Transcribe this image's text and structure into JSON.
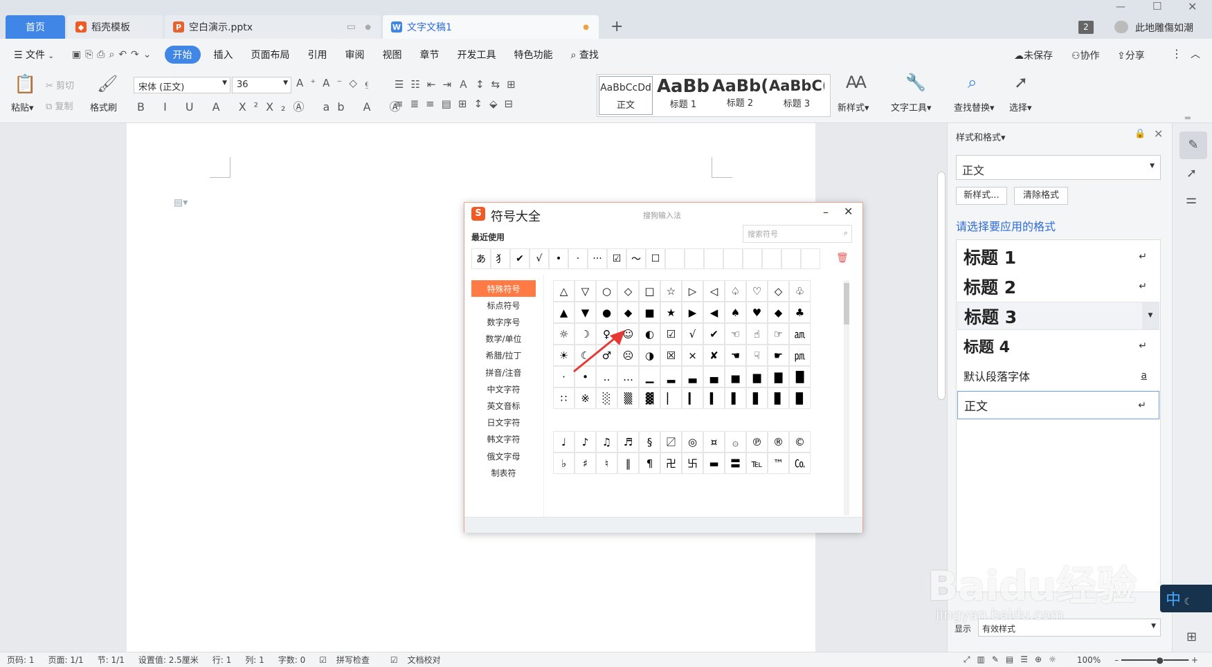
{
  "tabs": [
    {
      "label": "首页",
      "active": true
    },
    {
      "label": "稻壳模板"
    },
    {
      "label": "空白演示.pptx"
    },
    {
      "label": "文字文稿1",
      "current": true
    }
  ],
  "user": {
    "badge": "2",
    "name": "此地雕傷如潮"
  },
  "menu": {
    "file": "文件",
    "items": [
      "开始",
      "插入",
      "页面布局",
      "引用",
      "审阅",
      "视图",
      "章节",
      "开发工具",
      "特色功能"
    ],
    "search": "查找",
    "unsaved": "未保存",
    "collab": "协作",
    "share": "分享"
  },
  "ribbon": {
    "paste": "粘贴",
    "cut": "剪切",
    "copy": "复制",
    "format_painter": "格式刷",
    "font_name": "宋体 (正文)",
    "font_size": "36",
    "style_gallery": [
      {
        "preview": "AaBbCcDd",
        "label": "正文"
      },
      {
        "preview": "AaBb",
        "label": "标题 1"
      },
      {
        "preview": "AaBb(",
        "label": "标题 2"
      },
      {
        "preview": "AaBbC(",
        "label": "标题 3"
      }
    ],
    "new_style": "新样式",
    "text_tools": "文字工具",
    "find_replace": "查找替换",
    "select": "选择"
  },
  "dialog": {
    "title": "符号大全",
    "ime": "搜狗输入法",
    "recent_label": "最近使用",
    "search_placeholder": "搜索符号",
    "recent": [
      "あ",
      "⺨",
      "✔",
      "√",
      "•",
      "·",
      "···",
      "☑",
      "～",
      "☐",
      "",
      "",
      "",
      "",
      "",
      "",
      "",
      ""
    ],
    "categories": [
      "特殊符号",
      "标点符号",
      "数字序号",
      "数学/单位",
      "希腊/拉丁",
      "拼音/注音",
      "中文字符",
      "英文音标",
      "日文字符",
      "韩文字符",
      "俄文字母",
      "制表符"
    ],
    "grid1": [
      [
        "△",
        "▽",
        "○",
        "◇",
        "□",
        "☆",
        "▷",
        "◁",
        "♤",
        "♡",
        "◇",
        "♧"
      ],
      [
        "▲",
        "▼",
        "●",
        "◆",
        "■",
        "★",
        "▶",
        "◀",
        "♠",
        "♥",
        "◆",
        "♣"
      ],
      [
        "☼",
        "☽",
        "♀",
        "☺",
        "◐",
        "☑",
        "√",
        "✔",
        "☜",
        "☝",
        "☞",
        "㏂"
      ],
      [
        "☀",
        "☾",
        "♂",
        "☹",
        "◑",
        "☒",
        "×",
        "✘",
        "☚",
        "☟",
        "☛",
        "㏘"
      ],
      [
        "·",
        "•",
        "‥",
        "…",
        "▁",
        "▂",
        "▃",
        "▄",
        "▅",
        "▆",
        "▇",
        "█"
      ],
      [
        "∷",
        "※",
        "░",
        "▒",
        "▓",
        "▏",
        "▎",
        "▍",
        "▌",
        "▋",
        "▊",
        "▉"
      ]
    ],
    "grid2": [
      [
        "♩",
        "♪",
        "♫",
        "♬",
        "§",
        "〼",
        "◎",
        "¤",
        "۞",
        "℗",
        "®",
        "©"
      ],
      [
        "♭",
        "♯",
        "♮",
        "‖",
        "¶",
        "卍",
        "卐",
        "▬",
        "〓",
        "℡",
        "™",
        "㏇"
      ]
    ]
  },
  "pane": {
    "title": "样式和格式",
    "current_style": "正文",
    "new_style_btn": "新样式...",
    "clear_btn": "清除格式",
    "prompt": "请选择要应用的格式",
    "styles": [
      "标题 1",
      "标题 2",
      "标题 3",
      "标题 4"
    ],
    "default_font": "默认段落字体",
    "default_font_mark": "a",
    "body": "正文",
    "show_label": "显示",
    "show_value": "有效样式"
  },
  "status": {
    "items": [
      "页码: 1",
      "页面: 1/1",
      "节: 1/1",
      "设置值: 2.5厘米",
      "行: 1",
      "列: 1",
      "字数: 0",
      "拼写检查",
      "文档校对"
    ],
    "zoom": "100%"
  },
  "ime_badge": "中",
  "watermark": "Baidu经验",
  "watermark_url": "jingyan.baidu.com",
  "colors": {
    "accent": "#2d6bd8",
    "orange": "#ff7a45",
    "tab_active": "#3f86e6"
  }
}
